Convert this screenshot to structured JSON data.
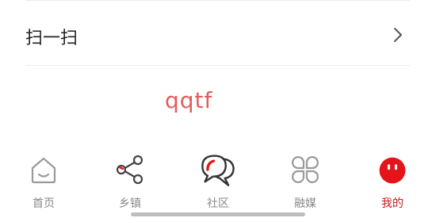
{
  "menu": {
    "scan_label": "扫一扫"
  },
  "profile": {
    "username": "qqtf"
  },
  "tabbar": {
    "tabs": [
      {
        "label": "首页",
        "icon": "home-icon"
      },
      {
        "label": "乡镇",
        "icon": "share-icon"
      },
      {
        "label": "社区",
        "icon": "chat-bubbles-icon"
      },
      {
        "label": "融媒",
        "icon": "grid-petals-icon"
      },
      {
        "label": "我的",
        "icon": "smiley-face-icon",
        "active": true
      }
    ]
  },
  "colors": {
    "accent": "#e4141b",
    "active_label": "#c41b1b",
    "username": "#e45b5b",
    "inactive": "#888888"
  }
}
